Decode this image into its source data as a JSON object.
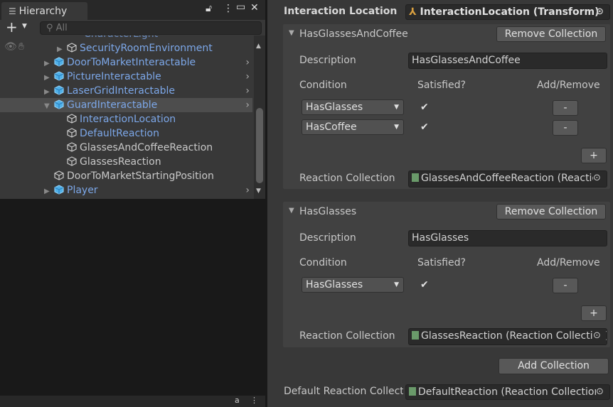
{
  "hierarchy": {
    "title": "Hierarchy",
    "search_placeholder": "All",
    "partial_item": "CharacterLight",
    "items": [
      {
        "label": "SecurityRoomEnvironment",
        "prefab": true,
        "indent": 2,
        "expandable": true
      },
      {
        "label": "DoorToMarketInteractable",
        "prefab": true,
        "indent": 1,
        "expandable": true
      },
      {
        "label": "PictureInteractable",
        "prefab": true,
        "indent": 1,
        "expandable": true
      },
      {
        "label": "LaserGridInteractable",
        "prefab": true,
        "indent": 1,
        "expandable": true
      },
      {
        "label": "GuardInteractable",
        "prefab": true,
        "indent": 1,
        "expandable": true,
        "expanded": true,
        "selected": true
      },
      {
        "label": "InteractionLocation",
        "prefab": true,
        "indent": 2
      },
      {
        "label": "DefaultReaction",
        "prefab": true,
        "indent": 2
      },
      {
        "label": "GlassesAndCoffeeReaction",
        "prefab": false,
        "indent": 2
      },
      {
        "label": "GlassesReaction",
        "prefab": false,
        "indent": 2
      },
      {
        "label": "DoorToMarketStartingPosition",
        "prefab": false,
        "indent": 1
      },
      {
        "label": "Player",
        "prefab": true,
        "indent": 1,
        "expandable": true
      }
    ]
  },
  "inspector": {
    "interaction_location_label": "Interaction Location",
    "interaction_location_value": "InteractionLocation (Transform)",
    "collections": [
      {
        "title": "HasGlassesAndCoffee",
        "remove_label": "Remove Collection",
        "description_label": "Description",
        "description_value": "HasGlassesAndCoffee",
        "condition_header": "Condition",
        "satisfied_header": "Satisfied?",
        "addremove_header": "Add/Remove",
        "conditions": [
          {
            "name": "HasGlasses",
            "satisfied": true
          },
          {
            "name": "HasCoffee",
            "satisfied": true
          }
        ],
        "minus_label": "-",
        "plus_label": "+",
        "reaction_label": "Reaction Collection",
        "reaction_value": "GlassesAndCoffeeReaction (Reaction Collection)"
      },
      {
        "title": "HasGlasses",
        "remove_label": "Remove Collection",
        "description_label": "Description",
        "description_value": "HasGlasses",
        "condition_header": "Condition",
        "satisfied_header": "Satisfied?",
        "addremove_header": "Add/Remove",
        "conditions": [
          {
            "name": "HasGlasses",
            "satisfied": true
          }
        ],
        "minus_label": "-",
        "plus_label": "+",
        "reaction_label": "Reaction Collection",
        "reaction_value": "GlassesReaction (Reaction Collection)"
      }
    ],
    "add_collection_label": "Add Collection",
    "default_reaction_label": "Default Reaction Collection",
    "default_reaction_value": "DefaultReaction (Reaction Collection)"
  },
  "colors": {
    "prefab_text": "#7ca7e8",
    "selected_row": "#4d4d4d"
  }
}
